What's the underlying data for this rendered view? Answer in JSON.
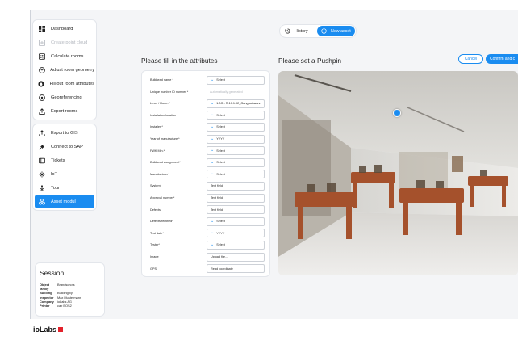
{
  "sidebar": {
    "group1": [
      {
        "label": "Dashboard",
        "icon": "dashboard-icon",
        "state": "normal"
      },
      {
        "label": "Create point cloud",
        "icon": "add-icon",
        "state": "disabled"
      },
      {
        "label": "Calculate rooms",
        "icon": "calculator-icon",
        "state": "normal"
      },
      {
        "label": "Adjust room geometry",
        "icon": "target-icon",
        "state": "normal"
      },
      {
        "label": "Fill out room attributes",
        "icon": "droplet-icon",
        "state": "normal"
      },
      {
        "label": "Georeferencing",
        "icon": "location-pin-icon",
        "state": "normal"
      },
      {
        "label": "Export rooms",
        "icon": "export-icon",
        "state": "normal"
      }
    ],
    "group2": [
      {
        "label": "Export to GIS",
        "icon": "export-icon",
        "state": "normal"
      },
      {
        "label": "Connect to SAP",
        "icon": "plug-icon",
        "state": "normal"
      },
      {
        "label": "Tickets",
        "icon": "ticket-icon",
        "state": "normal"
      },
      {
        "label": "IoT",
        "icon": "iot-icon",
        "state": "normal"
      },
      {
        "label": "Tour",
        "icon": "tour-icon",
        "state": "normal"
      },
      {
        "label": "Asset modul",
        "icon": "asset-module-icon",
        "state": "active"
      }
    ]
  },
  "session": {
    "title": "Session",
    "rows": [
      {
        "key": "Object family",
        "value": "Brandschots"
      },
      {
        "key": "Building",
        "value": "Building xy"
      },
      {
        "key": "Inspector",
        "value": "Max Mustermann"
      },
      {
        "key": "Company",
        "value": "ioLabs AG"
      },
      {
        "key": "Printer",
        "value": "cab EOS2"
      }
    ]
  },
  "logo": {
    "text": "ioLabs"
  },
  "toggle": {
    "history": "History",
    "new_asset": "New asset"
  },
  "form": {
    "heading": "Please fill in the attributes",
    "fields": [
      {
        "label": "Bulkhead name *",
        "value": "Select",
        "type": "select"
      },
      {
        "label": "Unique number ID number *",
        "value": "Automatically generated",
        "type": "readonly"
      },
      {
        "label": "Level / Room *",
        "value": "1.0G - R.10.1.02_Gang schwarz",
        "type": "select"
      },
      {
        "label": "Installation location",
        "value": "Select",
        "type": "select"
      },
      {
        "label": "Installer *",
        "value": "Select",
        "type": "select"
      },
      {
        "label": "Year of manufacture *",
        "value": "YYYY",
        "type": "select"
      },
      {
        "label": "FWK Min.*",
        "value": "Select",
        "type": "select"
      },
      {
        "label": "Bulkhead assignment*",
        "value": "Select",
        "type": "select"
      },
      {
        "label": "Manufacturer*",
        "value": "Select",
        "type": "select"
      },
      {
        "label": "System*",
        "value": "Text field",
        "type": "text"
      },
      {
        "label": "Approval number*",
        "value": "Text field",
        "type": "text"
      },
      {
        "label": "Defects",
        "value": "Text field",
        "type": "text"
      },
      {
        "label": "Defects rectified*",
        "value": "Select",
        "type": "select"
      },
      {
        "label": "Test date*",
        "value": "YYYY",
        "type": "select"
      },
      {
        "label": "Tester*",
        "value": "Select",
        "type": "select"
      },
      {
        "label": "Image",
        "value": "Upload file...",
        "type": "text"
      },
      {
        "label": "GPS",
        "value": "Read coordinate",
        "type": "text"
      }
    ]
  },
  "pushpin": {
    "heading": "Please set a Pushpin",
    "cancel": "Cancel",
    "confirm": "Confirm and c"
  },
  "colors": {
    "accent": "#1a8cf0"
  }
}
